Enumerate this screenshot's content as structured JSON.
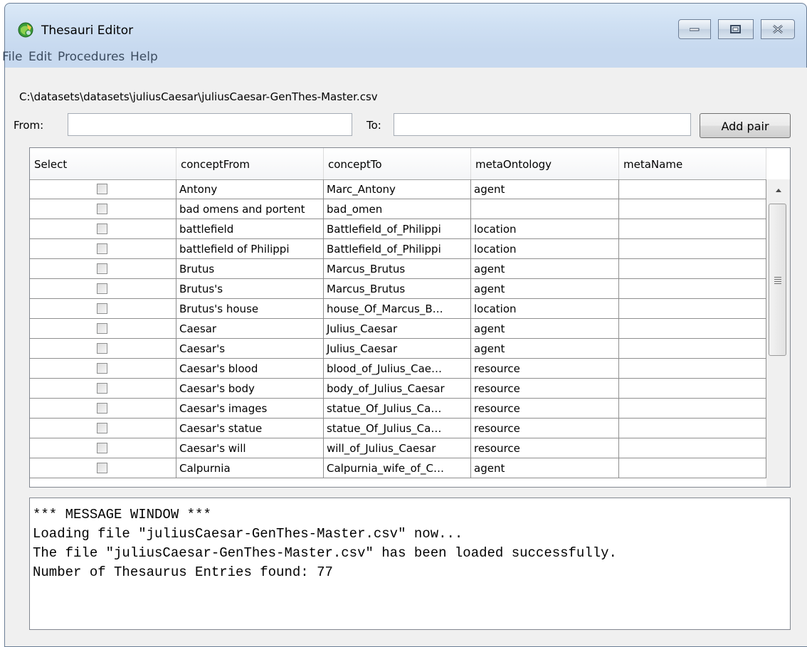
{
  "window": {
    "title": "Thesauri Editor",
    "icon": "app-globe-icon"
  },
  "menu": [
    "File",
    "Edit",
    "Procedures",
    "Help"
  ],
  "file_path": "C:\\datasets\\datasets\\juliusCaesar\\juliusCaesar-GenThes-Master.csv",
  "form": {
    "from_label": "From:",
    "from_value": "",
    "to_label": "To:",
    "to_value": "",
    "add_button": "Add pair"
  },
  "table": {
    "columns": [
      "Select",
      "conceptFrom",
      "conceptTo",
      "metaOntology",
      "metaName"
    ],
    "rows": [
      {
        "checked": false,
        "conceptFrom": "Antony",
        "conceptTo": "Marc_Antony",
        "metaOntology": "agent",
        "metaName": ""
      },
      {
        "checked": false,
        "conceptFrom": "bad omens and portent",
        "conceptTo": "bad_omen",
        "metaOntology": "",
        "metaName": ""
      },
      {
        "checked": false,
        "conceptFrom": "battlefield",
        "conceptTo": "Battlefield_of_Philippi",
        "metaOntology": "location",
        "metaName": ""
      },
      {
        "checked": false,
        "conceptFrom": "battlefield of Philippi",
        "conceptTo": "Battlefield_of_Philippi",
        "metaOntology": "location",
        "metaName": ""
      },
      {
        "checked": false,
        "conceptFrom": "Brutus",
        "conceptTo": "Marcus_Brutus",
        "metaOntology": "agent",
        "metaName": ""
      },
      {
        "checked": false,
        "conceptFrom": "Brutus's",
        "conceptTo": "Marcus_Brutus",
        "metaOntology": "agent",
        "metaName": ""
      },
      {
        "checked": false,
        "conceptFrom": "Brutus's house",
        "conceptTo": "house_Of_Marcus_B…",
        "metaOntology": "location",
        "metaName": ""
      },
      {
        "checked": false,
        "conceptFrom": "Caesar",
        "conceptTo": "Julius_Caesar",
        "metaOntology": "agent",
        "metaName": ""
      },
      {
        "checked": false,
        "conceptFrom": "Caesar's",
        "conceptTo": "Julius_Caesar",
        "metaOntology": "agent",
        "metaName": ""
      },
      {
        "checked": false,
        "conceptFrom": "Caesar's blood",
        "conceptTo": "blood_of_Julius_Cae…",
        "metaOntology": "resource",
        "metaName": ""
      },
      {
        "checked": false,
        "conceptFrom": "Caesar's body",
        "conceptTo": "body_of_Julius_Caesar",
        "metaOntology": "resource",
        "metaName": ""
      },
      {
        "checked": false,
        "conceptFrom": "Caesar's images",
        "conceptTo": "statue_Of_Julius_Ca…",
        "metaOntology": "resource",
        "metaName": ""
      },
      {
        "checked": false,
        "conceptFrom": "Caesar's statue",
        "conceptTo": "statue_Of_Julius_Ca…",
        "metaOntology": "resource",
        "metaName": ""
      },
      {
        "checked": false,
        "conceptFrom": "Caesar's will",
        "conceptTo": "will_of_Julius_Caesar",
        "metaOntology": "resource",
        "metaName": ""
      },
      {
        "checked": false,
        "conceptFrom": "Calpurnia",
        "conceptTo": "Calpurnia_wife_of_C…",
        "metaOntology": "agent",
        "metaName": ""
      }
    ]
  },
  "messages": [
    "*** MESSAGE WINDOW ***",
    "Loading file \"juliusCaesar-GenThes-Master.csv\" now...",
    "The file \"juliusCaesar-GenThes-Master.csv\" has been loaded successfully.",
    "Number of Thesaurus Entries found: 77"
  ]
}
